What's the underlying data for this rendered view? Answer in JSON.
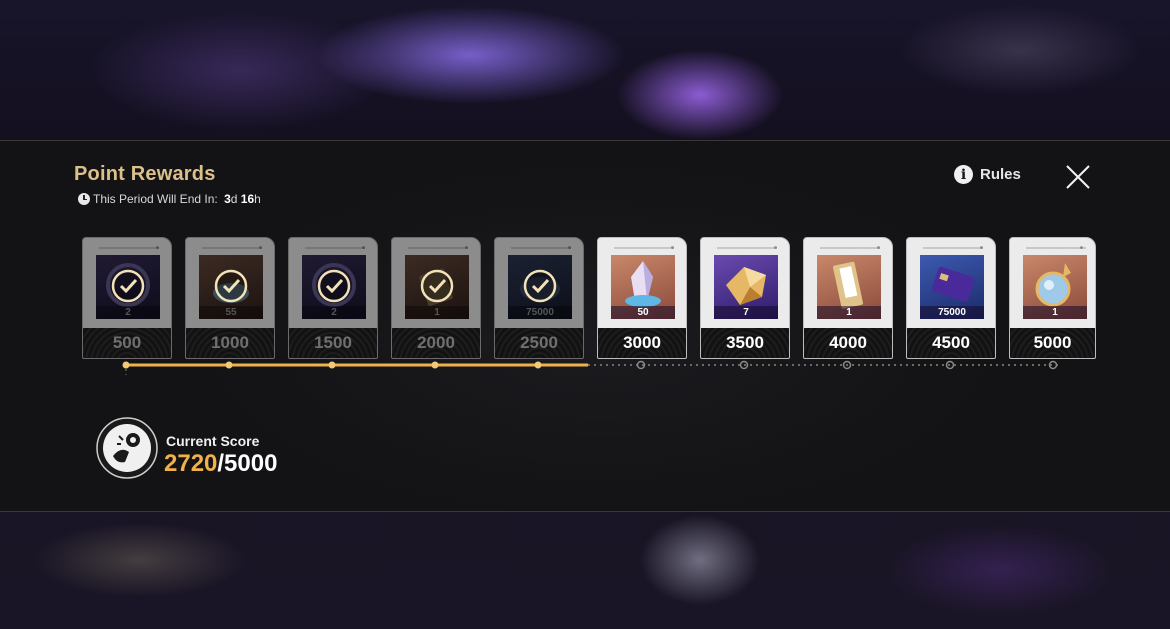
{
  "header": {
    "title": "Point Rewards",
    "period_label": "This Period Will End In:",
    "period_days": "3",
    "period_days_unit": "d",
    "period_hours": "16",
    "period_hours_unit": "h",
    "rules_label": "Rules"
  },
  "rewards": [
    {
      "points": "500",
      "qty": "2",
      "claimed": true,
      "icon": "badge-icon"
    },
    {
      "points": "1000",
      "qty": "55",
      "claimed": true,
      "icon": "material-icon"
    },
    {
      "points": "1500",
      "qty": "2",
      "claimed": true,
      "icon": "badge-icon"
    },
    {
      "points": "2000",
      "qty": "1",
      "claimed": true,
      "icon": "ticket-icon"
    },
    {
      "points": "2500",
      "qty": "75000",
      "claimed": true,
      "icon": "credits-icon"
    },
    {
      "points": "3000",
      "qty": "50",
      "claimed": false,
      "icon": "crystal-icon"
    },
    {
      "points": "3500",
      "qty": "7",
      "claimed": false,
      "icon": "gold-ore-icon"
    },
    {
      "points": "4000",
      "qty": "1",
      "claimed": false,
      "icon": "pass-card-icon"
    },
    {
      "points": "4500",
      "qty": "75000",
      "claimed": false,
      "icon": "credit-card-icon"
    },
    {
      "points": "5000",
      "qty": "1",
      "claimed": false,
      "icon": "orb-icon"
    }
  ],
  "score": {
    "label": "Current Score",
    "current": "2720",
    "max": "/5000",
    "progress_fraction": 0.544
  },
  "colors": {
    "accent_gold": "#dcc08c",
    "progress": "#f0b04a"
  }
}
